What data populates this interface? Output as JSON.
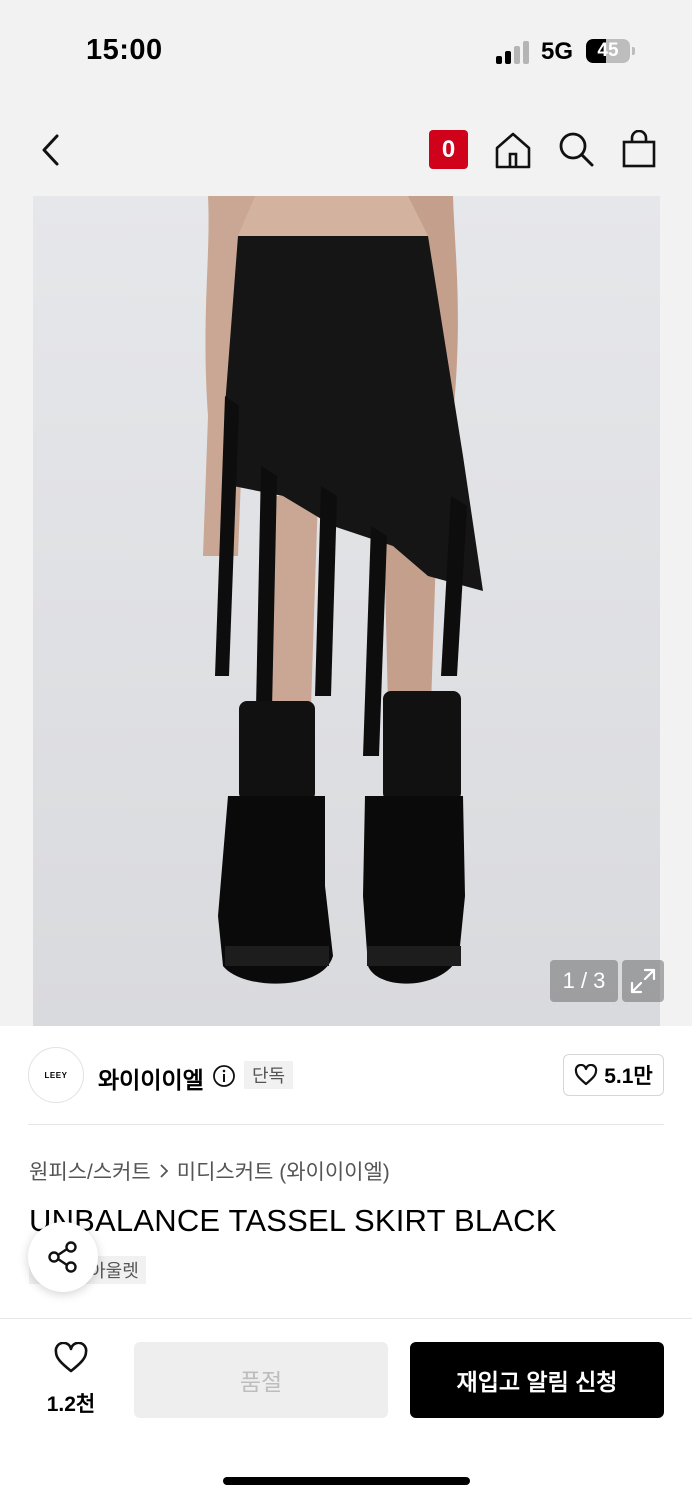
{
  "status_bar": {
    "time": "15:00",
    "network": "5G",
    "battery": "45",
    "battery_level": 0.45
  },
  "header": {
    "back_icon": "chevron-left-icon",
    "badge": "0",
    "home_icon": "home-icon",
    "search_icon": "search-icon",
    "bag_icon": "shopping-bag-icon"
  },
  "gallery": {
    "pager": "1 / 3",
    "expand_icon": "expand-icon"
  },
  "brand": {
    "logo_text": "LEEY",
    "name": "와이이이엘",
    "exclusive_tag": "단독",
    "likes": "5.1만"
  },
  "product": {
    "breadcrumb_category": "원피스/스커트",
    "breadcrumb_sub": "미디스커트 (와이이이엘)",
    "title": "UNBALANCE TASSEL SKIRT BLACK",
    "tags": [
      "단독",
      "아울렛"
    ]
  },
  "bottom_bar": {
    "wish_count": "1.2천",
    "soldout_label": "품절",
    "restock_label": "재입고 알림 신청"
  },
  "colors": {
    "accent_red": "#d0021b",
    "primary_button": "#000000",
    "disabled_button": "#eeeeee"
  }
}
